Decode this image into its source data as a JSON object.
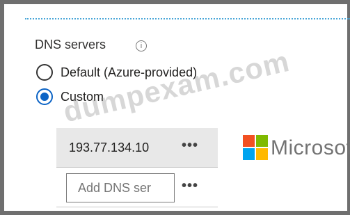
{
  "dns": {
    "label": "DNS servers",
    "info_symbol": "i",
    "options": [
      {
        "label": "Default (Azure-provided)",
        "selected": false
      },
      {
        "label": "Custom",
        "selected": true
      }
    ],
    "server_value": "193.77.134.10",
    "more_symbol": "•••",
    "add_placeholder": "Add DNS ser"
  },
  "overlay": {
    "brand_text": "Microsoft",
    "watermark": "dumpexam.com"
  },
  "colors": {
    "accent": "#0b63c5",
    "ms_red": "#f25022",
    "ms_green": "#7fba00",
    "ms_blue": "#00a4ef",
    "ms_yellow": "#ffb900"
  }
}
